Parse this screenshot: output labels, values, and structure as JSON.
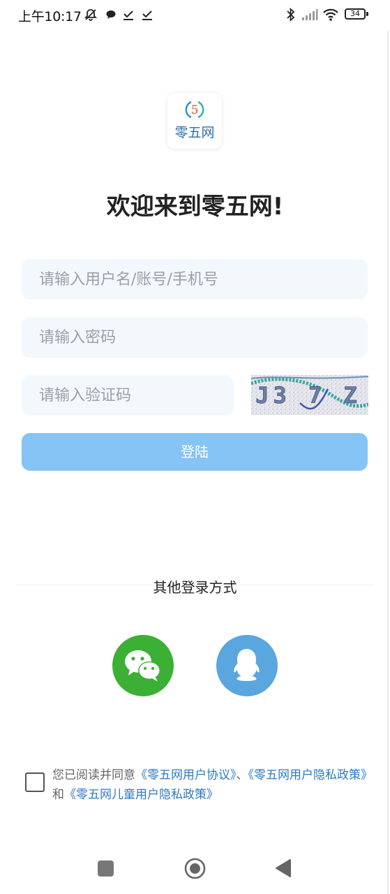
{
  "status_bar": {
    "time": "上午10:17",
    "battery": "34"
  },
  "logo": {
    "number": "5",
    "text": "零五网"
  },
  "welcome_title": "欢迎来到零五网!",
  "form": {
    "username_placeholder": "请输入用户名/账号/手机号",
    "password_placeholder": "请输入密码",
    "captcha_placeholder": "请输入验证码",
    "captcha_code": "J3 7 Z",
    "login_label": "登陆"
  },
  "other_login": {
    "label": "其他登录方式",
    "methods": [
      "wechat-icon",
      "qq-icon"
    ]
  },
  "agreement": {
    "prefix": "您已阅读并同意",
    "link1": "《零五网用户协议》",
    "sep1": "、",
    "link2": "《零五网用户隐私政策》",
    "sep2": "和",
    "link3": "《零五网儿童用户隐私政策》"
  },
  "colors": {
    "login_button": "#85c4f5",
    "input_bg": "#f3f8fd",
    "wechat": "#3cb034",
    "qq": "#5aa6de",
    "link": "#2a7ac4"
  }
}
